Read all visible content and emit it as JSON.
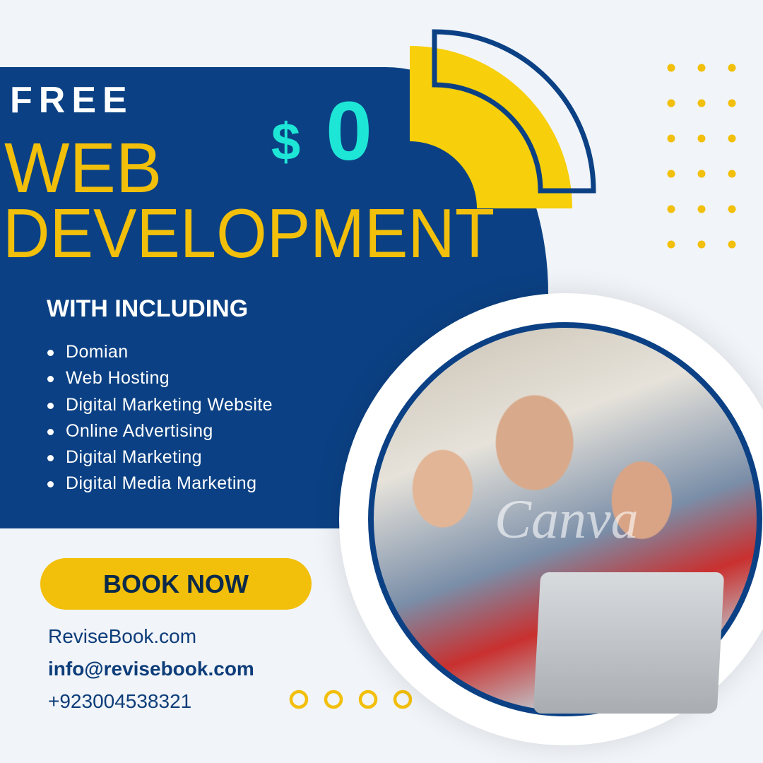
{
  "headline": {
    "free": "FREE",
    "line1": "WEB",
    "line2": "DEVELOPMENT"
  },
  "price": {
    "currency": "$",
    "amount": "0"
  },
  "features": {
    "title": "WITH INCLUDING",
    "items": [
      "Domian",
      "Web Hosting",
      "Digital Marketing Website",
      "Online Advertising",
      "Digital Marketing",
      "Digital Media Marketing"
    ]
  },
  "cta": {
    "label": "BOOK NOW"
  },
  "contact": {
    "website": "ReviseBook.com",
    "email": "info@revisebook.com",
    "phone": "+923004538321"
  },
  "photo": {
    "description_icon": "people-at-laptop-photo",
    "watermark": "Canva"
  },
  "colors": {
    "navy": "#0b4184",
    "yellow": "#f2bf0a",
    "cyan": "#1ee6d6",
    "background": "#f1f4f8"
  }
}
